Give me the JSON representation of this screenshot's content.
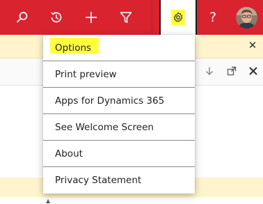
{
  "topbar": {
    "background": "#d9232f",
    "icons": [
      "search-icon",
      "recent-icon",
      "add-icon",
      "filter-icon",
      "settings-icon",
      "help-icon",
      "avatar"
    ],
    "help_label": "?"
  },
  "notification": {
    "close_glyph": "✕"
  },
  "toolbar": {
    "icons": [
      "arrow-down-icon",
      "expand-icon",
      "close-icon"
    ]
  },
  "settings_menu": {
    "items": [
      {
        "label": "Options",
        "highlighted": true
      },
      {
        "label": "Print preview"
      },
      {
        "label": "Apps for Dynamics 365"
      },
      {
        "label": "See Welcome Screen"
      },
      {
        "label": "About"
      },
      {
        "label": "Privacy Statement"
      }
    ]
  },
  "colors": {
    "highlight": "#ffff3b",
    "notification_bg": "#fff4cc"
  }
}
